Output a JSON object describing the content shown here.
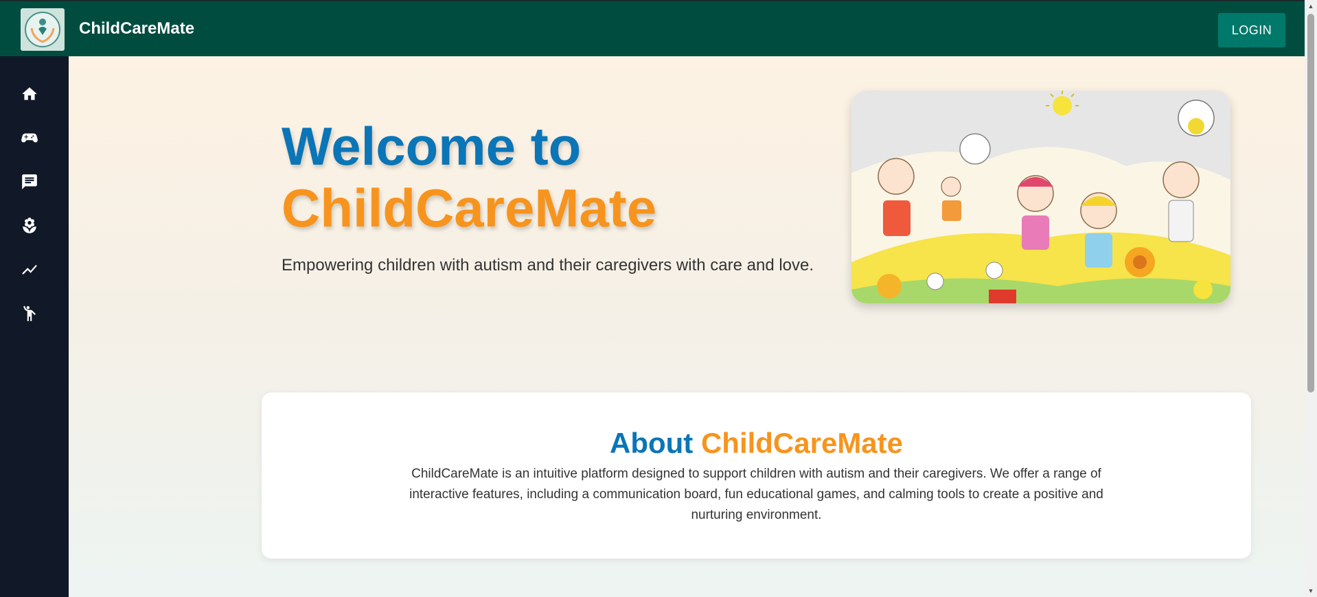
{
  "app": {
    "title": "ChildCareMate",
    "login_label": "LOGIN"
  },
  "sidebar": {
    "items": [
      {
        "icon": "home-icon"
      },
      {
        "icon": "gamepad-icon"
      },
      {
        "icon": "chat-icon"
      },
      {
        "icon": "lotus-icon"
      },
      {
        "icon": "trending-icon"
      },
      {
        "icon": "person-waving-icon"
      }
    ]
  },
  "hero": {
    "title_line1": "Welcome to",
    "title_line2": "ChildCareMate",
    "subtitle": "Empowering children with autism and their caregivers with care and love."
  },
  "about": {
    "title_part1": "About",
    "title_part2": "ChildCareMate",
    "text": "ChildCareMate is an intuitive platform designed to support children with autism and their caregivers. We offer a range of interactive features, including a communication board, fun educational games, and calming tools to create a positive and nurturing environment."
  },
  "colors": {
    "topbar": "#004d40",
    "sidebar": "#111827",
    "accent_blue": "#0a75b7",
    "accent_orange": "#f7941d",
    "login_button": "#00796b"
  }
}
